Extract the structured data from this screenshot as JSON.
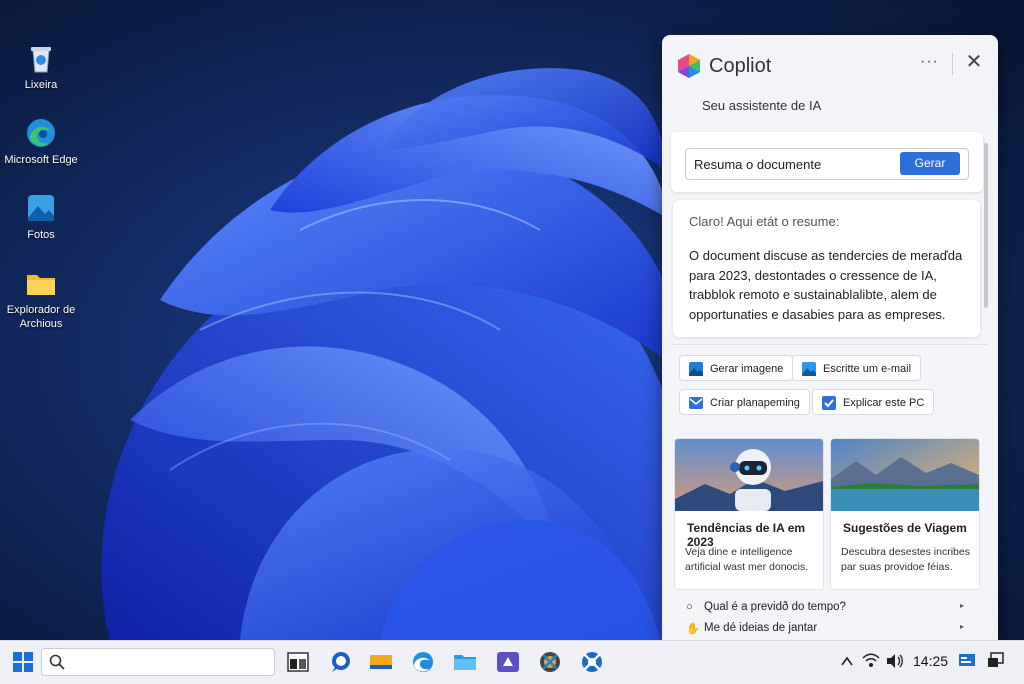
{
  "desktop": {
    "icons": [
      {
        "label": "Lixeira",
        "icon": "recycle-bin-icon"
      },
      {
        "label": "Microsoft Edge",
        "icon": "edge-icon"
      },
      {
        "label": "Fotos",
        "icon": "photos-icon"
      },
      {
        "label": "Explorador de Archious",
        "icon": "folder-icon"
      }
    ]
  },
  "copilot": {
    "title": "Copliot",
    "more_label": "···",
    "close_label": "✕",
    "subtitle": "Seu assistente de IA",
    "prompt": {
      "value": "Resuma o documente",
      "button_label": "Gerar"
    },
    "answer": {
      "intro": "Claro! Aqui etát o resume:",
      "body": "O document discuse as tendercies de meraďda para 2023, destontades o cressence de IA, trabblok remoto e sustainablalibte, alem de opportunaties e dasabies para as empreses."
    },
    "chips": [
      {
        "label": "Gerar imagene",
        "icon": "image-icon"
      },
      {
        "label": "Escritte um e-mail",
        "icon": "image-icon"
      },
      {
        "label": "Criar planapeming",
        "icon": "mail-icon"
      },
      {
        "label": "Explicar este PC",
        "icon": "checkbox-icon"
      }
    ],
    "cards": [
      {
        "title": "Tendências de IA em 2023",
        "desc": "Veja dine e intelligence artificial wast mer donocis."
      },
      {
        "title": "Sugestões de Viagem",
        "desc": "Descubra desestes incribes par suas providoe féias."
      }
    ],
    "suggestions": [
      {
        "icon": "○",
        "label": "Qual é a previdð do tempo?",
        "arrow": "▸"
      },
      {
        "icon": "✋",
        "label": "Me dé ideias de jantar",
        "arrow": "▸"
      }
    ]
  },
  "taskbar": {
    "search_placeholder": "",
    "time": "14:25",
    "tray_icons": [
      "chevron-up-icon",
      "wifi-icon",
      "volume-icon",
      "notification-icon",
      "display-icon"
    ]
  },
  "colors": {
    "accent": "#2f6fd8",
    "taskbar": "#eef0f6",
    "panel": "#f3f4f7"
  }
}
